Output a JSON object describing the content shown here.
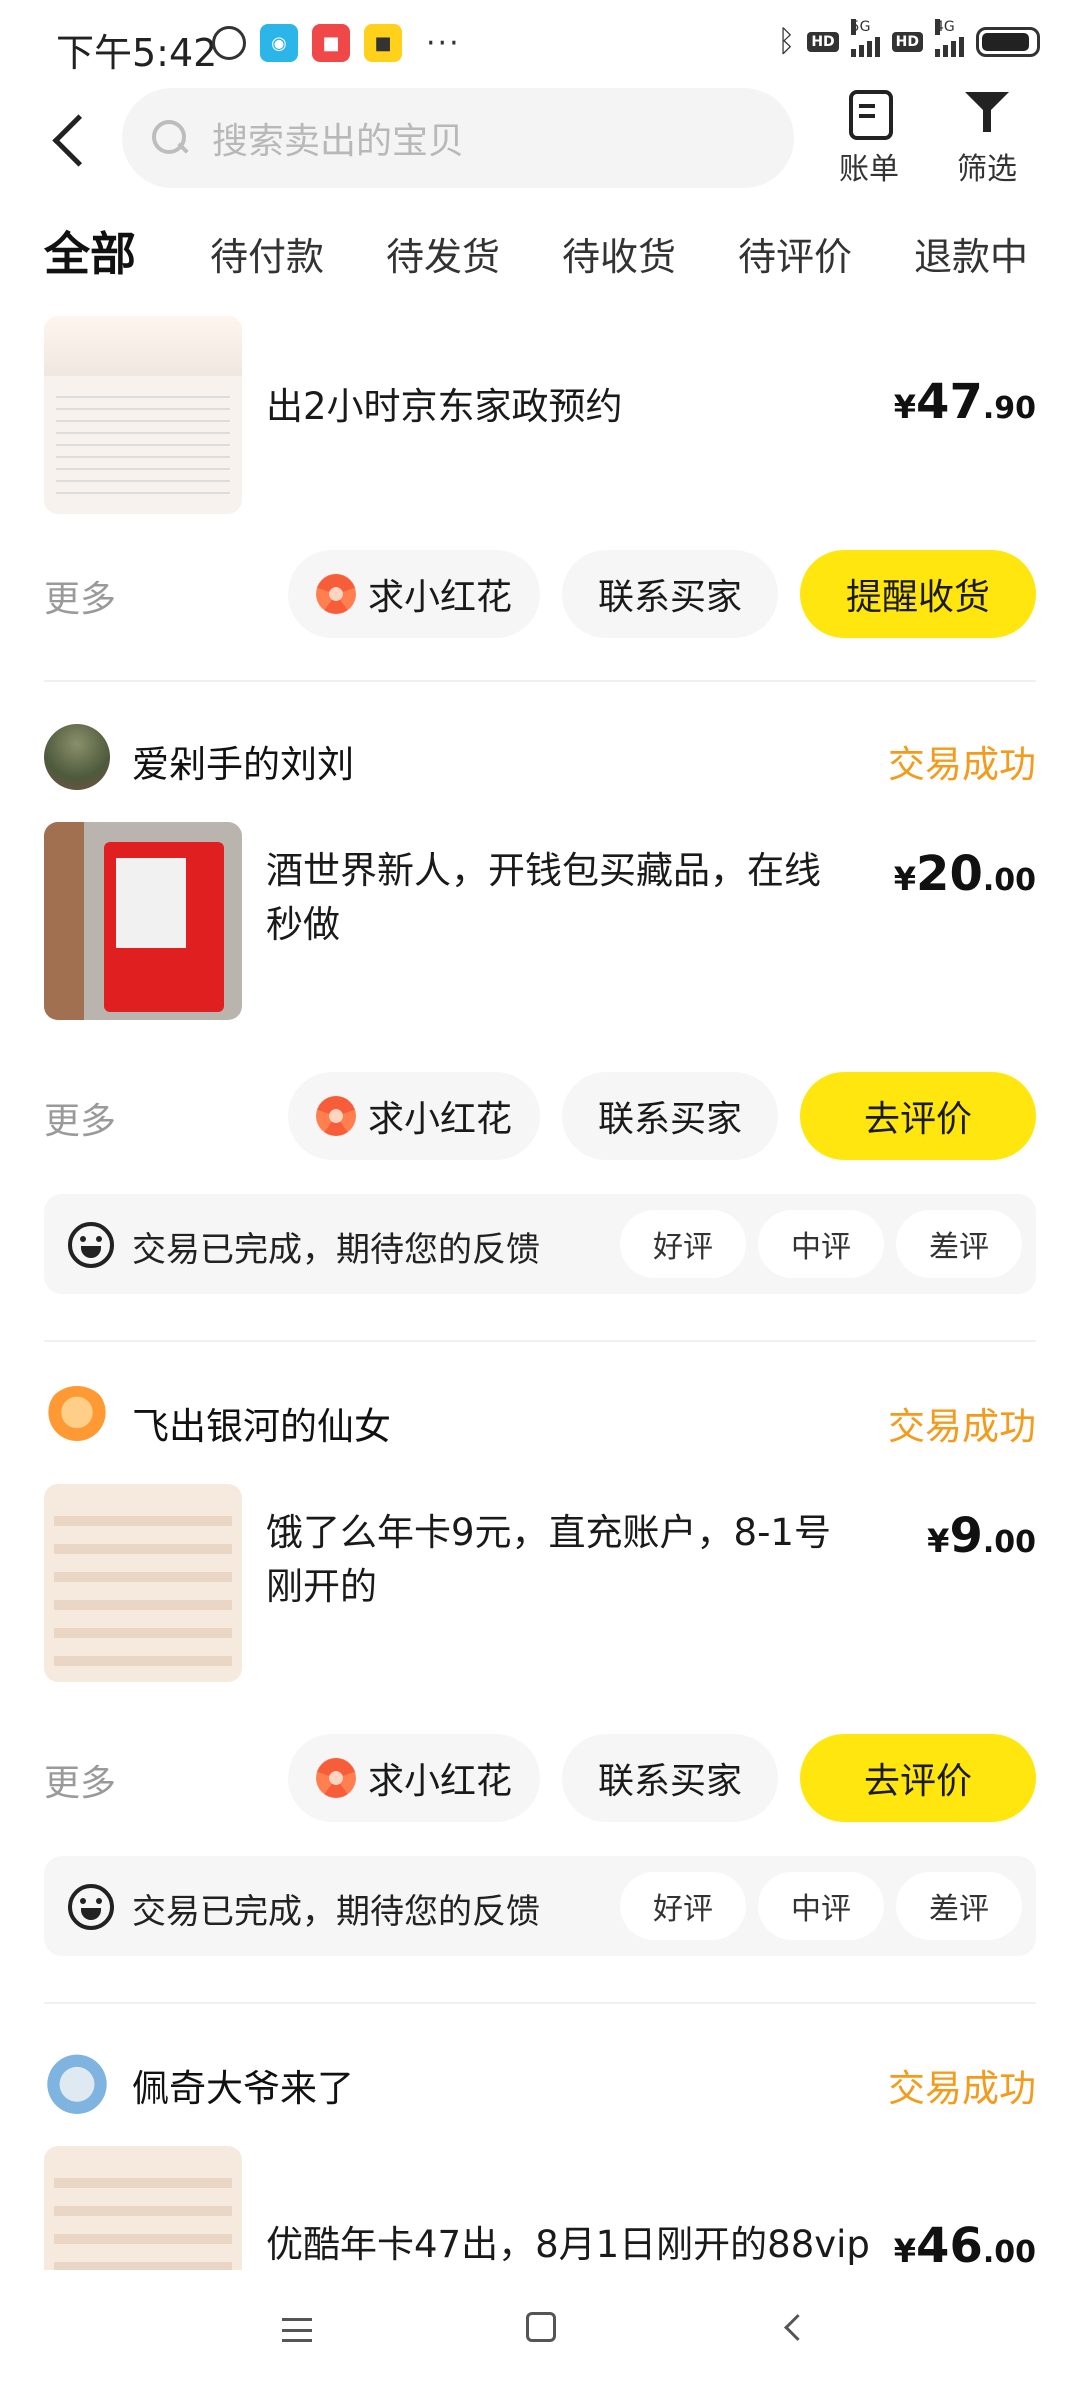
{
  "status_bar": {
    "time": "下午5:42",
    "more": "···",
    "network1": "5G",
    "network2": "4G",
    "hd": "HD"
  },
  "header": {
    "search_placeholder": "搜索卖出的宝贝",
    "bill_label": "账单",
    "filter_label": "筛选"
  },
  "tabs": [
    "全部",
    "待付款",
    "待发货",
    "待收货",
    "待评价",
    "退款中"
  ],
  "common": {
    "more": "更多",
    "flower_btn": "求小红花",
    "contact_btn": "联系买家",
    "feedback_text": "交易已完成，期待您的反馈",
    "good": "好评",
    "mid": "中评",
    "bad": "差评"
  },
  "orders": [
    {
      "title": "出2小时京东家政预约",
      "price_int": "47",
      "price_dec": ".90",
      "action": "提醒收货"
    },
    {
      "seller": "爱剁手的刘刘",
      "status": "交易成功",
      "title": "酒世界新人，开钱包买藏品，在线秒做",
      "price_int": "20",
      "price_dec": ".00",
      "action": "去评价"
    },
    {
      "seller": "飞出银河的仙女",
      "status": "交易成功",
      "title": "饿了么年卡9元，直充账户，8-1号刚开的",
      "price_int": "9",
      "price_dec": ".00",
      "action": "去评价"
    },
    {
      "seller": "佩奇大爷来了",
      "status": "交易成功",
      "title": "优酷年卡47出，8月1日刚开的88vip",
      "price_int": "46",
      "price_dec": ".00"
    }
  ],
  "currency": "¥",
  "colors": {
    "accent_yellow": "#ffe60f",
    "status_orange": "#f49b1b"
  }
}
